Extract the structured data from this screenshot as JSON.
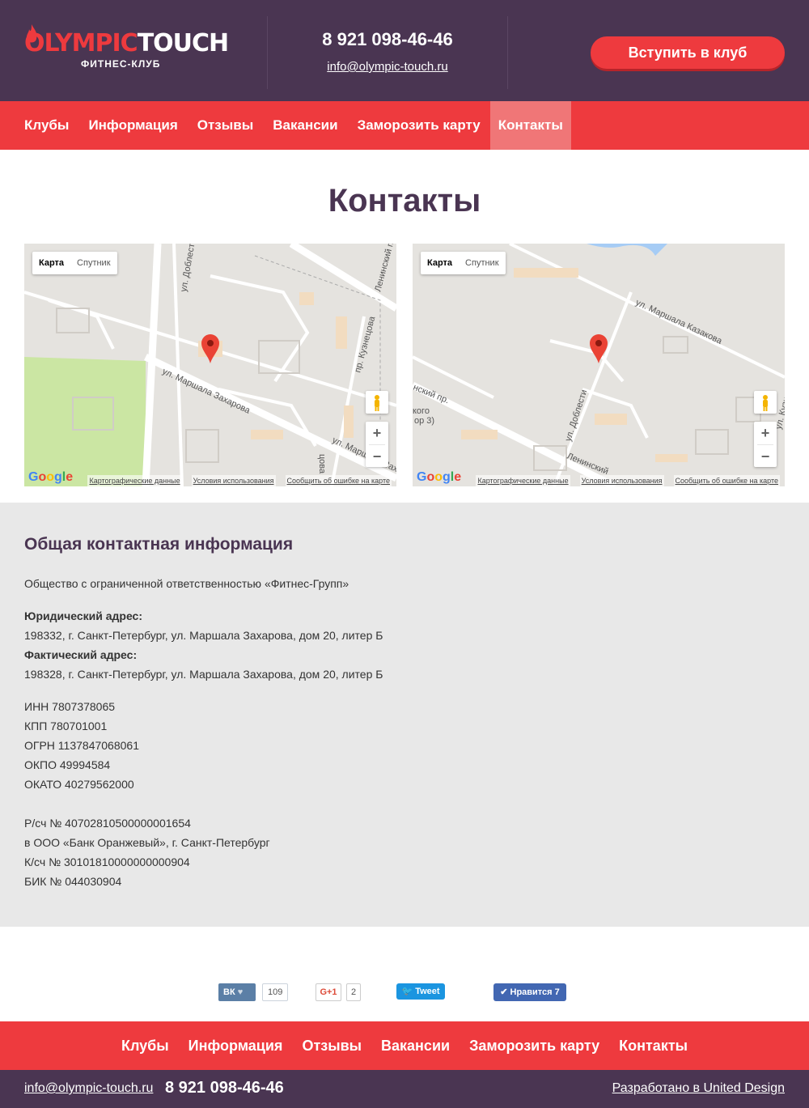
{
  "header": {
    "logo_part1": "OLYMPIC",
    "logo_part2": "TOUCH",
    "logo_sub": "ФИТНЕС-КЛУБ",
    "phone": "8 921 098-46-46",
    "email": "info@olympic-touch.ru",
    "join_label": "Вступить в клуб"
  },
  "nav": {
    "items": [
      {
        "label": "Клубы"
      },
      {
        "label": "Информация"
      },
      {
        "label": "Отзывы"
      },
      {
        "label": "Вакансии"
      },
      {
        "label": "Заморозить карту"
      },
      {
        "label": "Контакты",
        "active": true
      }
    ]
  },
  "page": {
    "title": "Контакты"
  },
  "maps": [
    {
      "type_map": "Карта",
      "type_sat": "Спутник",
      "zoom_in": "+",
      "zoom_out": "−",
      "footer": [
        "Картографические данные",
        "Условия использования",
        "Сообщить об ошибке на карте"
      ],
      "streets": [
        "ул. Доблести",
        "ул. Маршала Захарова",
        "пр. Кузнецова",
        "Ленинский пр.",
        "ул. Маршала Захарова",
        "цова"
      ]
    },
    {
      "type_map": "Карта",
      "type_sat": "Спутник",
      "zoom_in": "+",
      "zoom_out": "−",
      "footer": [
        "Картографические данные",
        "Условия использования",
        "Сообщить об ошибке на карте"
      ],
      "streets": [
        "ул. Маршала Казакова",
        "ул. Доблести",
        "нский пр.",
        "кого",
        "ор 3)",
        "Ленинский",
        "ул. Кузн"
      ]
    }
  ],
  "info": {
    "heading": "Общая контактная информация",
    "company": "Общество с ограниченной ответственностью «Фитнес-Групп»",
    "legal_label": "Юридический адрес:",
    "legal_address": "198332, г. Санкт-Петербург, ул. Маршала Захарова, дом 20, литер Б",
    "actual_label": "Фактический адрес:",
    "actual_address": "198328, г. Санкт-Петербург, ул. Маршала Захарова, дом 20, литер Б",
    "inn": "ИНН 7807378065",
    "kpp": "КПП 780701001",
    "ogrn": "ОГРН 1137847068061",
    "okpo": "ОКПО 49994584",
    "okato": "ОКАТО 40279562000",
    "account": "Р/сч № 40702810500000001654",
    "bank": "в ООО «Банк Оранжевый», г. Санкт-Петербург",
    "corr_account": "К/сч № 30101810000000000904",
    "bik": "БИК № 044030904"
  },
  "social": {
    "vk_label": "ВК",
    "vk_count": "109",
    "gplus_label": "G+1",
    "gplus_count": "2",
    "tweet_label": "Tweet",
    "fb_label": "Нравится 7"
  },
  "footer": {
    "email": "info@olympic-touch.ru",
    "phone": "8 921 098-46-46",
    "developer": "Разработано в United Design"
  },
  "colors": {
    "brand_purple": "#4a3552",
    "brand_red": "#ee3a3e",
    "nav_active": "#f07677",
    "info_bg": "#e8e8e8"
  }
}
